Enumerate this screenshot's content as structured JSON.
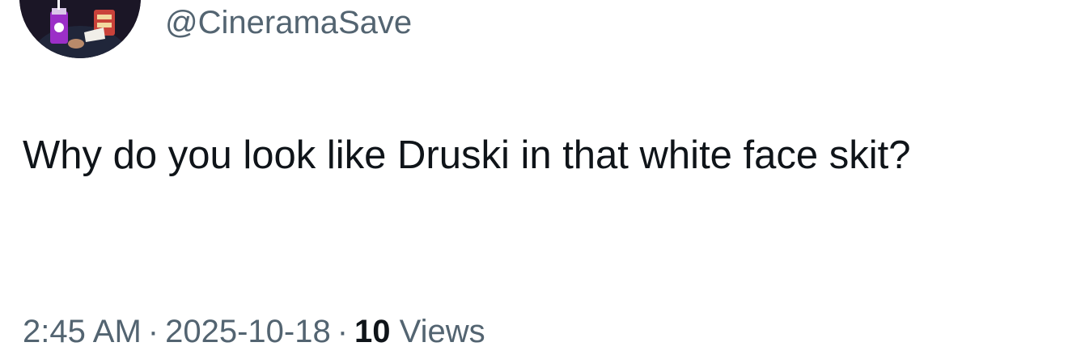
{
  "author": {
    "handle": "@CineramaSave",
    "avatar_icon": "profile-avatar-moviegoer"
  },
  "tweet": {
    "text": "Why do you look like Druski in that white face skit?"
  },
  "meta": {
    "time": "2:45 AM",
    "separator": "·",
    "date": "2025-10-18",
    "views_count": "10",
    "views_label": "Views"
  },
  "colors": {
    "text_primary": "#0f1419",
    "text_secondary": "#536471",
    "background": "#ffffff"
  }
}
